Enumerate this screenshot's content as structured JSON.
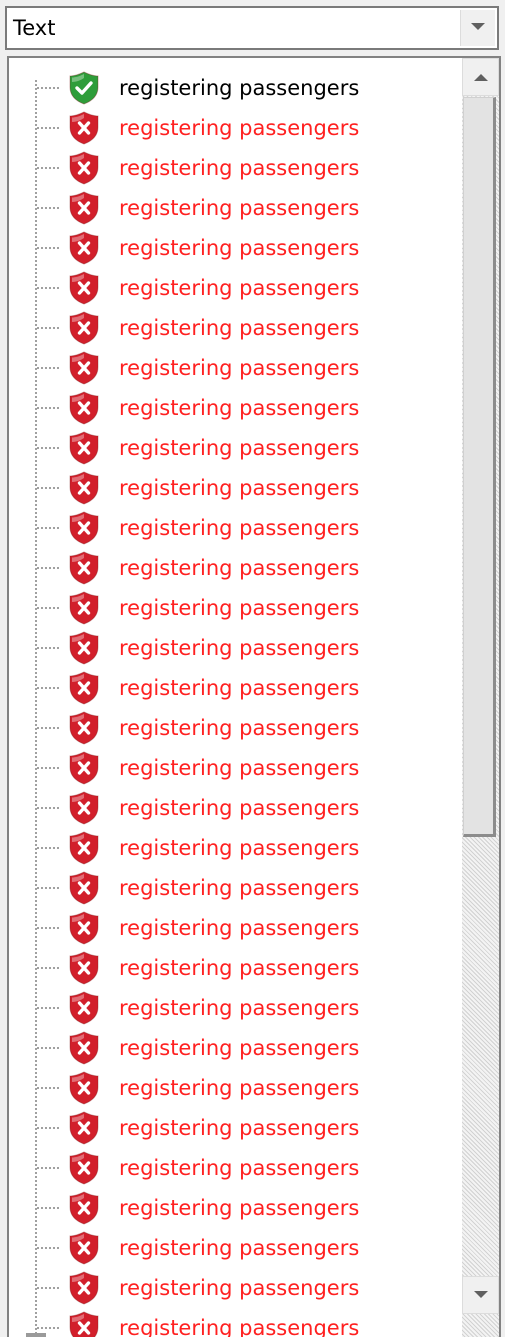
{
  "combo": {
    "value": "Text",
    "button_icon": "chevron-down-icon"
  },
  "colors": {
    "ok_text": "#000000",
    "error_text": "#ff2020",
    "ok_shield": "#2e9d3a",
    "error_shield": "#d21f2b"
  },
  "tree": {
    "items": [
      {
        "label": "registering passengers",
        "status": "ok",
        "icon": "green-shield-check-icon"
      },
      {
        "label": "registering passengers",
        "status": "error",
        "icon": "red-shield-x-icon"
      },
      {
        "label": "registering passengers",
        "status": "error",
        "icon": "red-shield-x-icon"
      },
      {
        "label": "registering passengers",
        "status": "error",
        "icon": "red-shield-x-icon"
      },
      {
        "label": "registering passengers",
        "status": "error",
        "icon": "red-shield-x-icon"
      },
      {
        "label": "registering passengers",
        "status": "error",
        "icon": "red-shield-x-icon"
      },
      {
        "label": "registering passengers",
        "status": "error",
        "icon": "red-shield-x-icon"
      },
      {
        "label": "registering passengers",
        "status": "error",
        "icon": "red-shield-x-icon"
      },
      {
        "label": "registering passengers",
        "status": "error",
        "icon": "red-shield-x-icon"
      },
      {
        "label": "registering passengers",
        "status": "error",
        "icon": "red-shield-x-icon"
      },
      {
        "label": "registering passengers",
        "status": "error",
        "icon": "red-shield-x-icon"
      },
      {
        "label": "registering passengers",
        "status": "error",
        "icon": "red-shield-x-icon"
      },
      {
        "label": "registering passengers",
        "status": "error",
        "icon": "red-shield-x-icon"
      },
      {
        "label": "registering passengers",
        "status": "error",
        "icon": "red-shield-x-icon"
      },
      {
        "label": "registering passengers",
        "status": "error",
        "icon": "red-shield-x-icon"
      },
      {
        "label": "registering passengers",
        "status": "error",
        "icon": "red-shield-x-icon"
      },
      {
        "label": "registering passengers",
        "status": "error",
        "icon": "red-shield-x-icon"
      },
      {
        "label": "registering passengers",
        "status": "error",
        "icon": "red-shield-x-icon"
      },
      {
        "label": "registering passengers",
        "status": "error",
        "icon": "red-shield-x-icon"
      },
      {
        "label": "registering passengers",
        "status": "error",
        "icon": "red-shield-x-icon"
      },
      {
        "label": "registering passengers",
        "status": "error",
        "icon": "red-shield-x-icon"
      },
      {
        "label": "registering passengers",
        "status": "error",
        "icon": "red-shield-x-icon"
      },
      {
        "label": "registering passengers",
        "status": "error",
        "icon": "red-shield-x-icon"
      },
      {
        "label": "registering passengers",
        "status": "error",
        "icon": "red-shield-x-icon"
      },
      {
        "label": "registering passengers",
        "status": "error",
        "icon": "red-shield-x-icon"
      },
      {
        "label": "registering passengers",
        "status": "error",
        "icon": "red-shield-x-icon"
      },
      {
        "label": "registering passengers",
        "status": "error",
        "icon": "red-shield-x-icon"
      },
      {
        "label": "registering passengers",
        "status": "error",
        "icon": "red-shield-x-icon"
      },
      {
        "label": "registering passengers",
        "status": "error",
        "icon": "red-shield-x-icon"
      },
      {
        "label": "registering passengers",
        "status": "error",
        "icon": "red-shield-x-icon"
      },
      {
        "label": "registering passengers",
        "status": "error",
        "icon": "red-shield-x-icon"
      },
      {
        "label": "registering passengers",
        "status": "error",
        "icon": "red-shield-x-icon"
      }
    ]
  },
  "scrollbar": {
    "up_icon": "scroll-up-arrow-icon",
    "down_icon": "scroll-down-arrow-icon"
  }
}
